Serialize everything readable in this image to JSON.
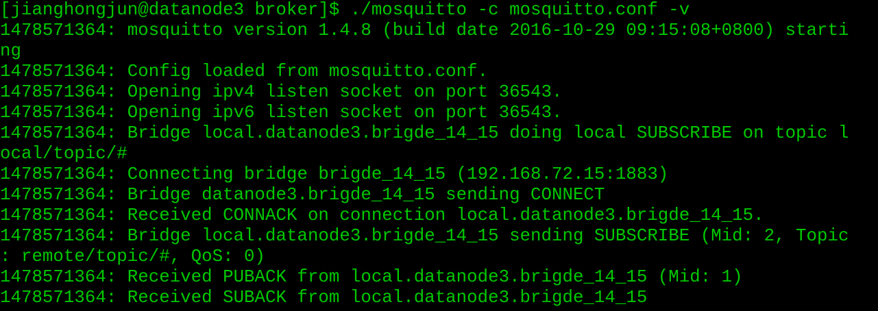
{
  "terminal": {
    "text_color": "#00c800",
    "background_color": "#000000",
    "lines": [
      "[jianghongjun@datanode3 broker]$ ./mosquitto -c mosquitto.conf -v",
      "1478571364: mosquitto version 1.4.8 (build date 2016-10-29 09:15:08+0800) starti",
      "ng",
      "1478571364: Config loaded from mosquitto.conf.",
      "1478571364: Opening ipv4 listen socket on port 36543.",
      "1478571364: Opening ipv6 listen socket on port 36543.",
      "1478571364: Bridge local.datanode3.brigde_14_15 doing local SUBSCRIBE on topic l",
      "ocal/topic/#",
      "1478571364: Connecting bridge brigde_14_15 (192.168.72.15:1883)",
      "1478571364: Bridge datanode3.brigde_14_15 sending CONNECT",
      "1478571364: Received CONNACK on connection local.datanode3.brigde_14_15.",
      "1478571364: Bridge local.datanode3.brigde_14_15 sending SUBSCRIBE (Mid: 2, Topic",
      ": remote/topic/#, QoS: 0)",
      "1478571364: Received PUBACK from local.datanode3.brigde_14_15 (Mid: 1)",
      "1478571364: Received SUBACK from local.datanode3.brigde_14_15"
    ]
  }
}
